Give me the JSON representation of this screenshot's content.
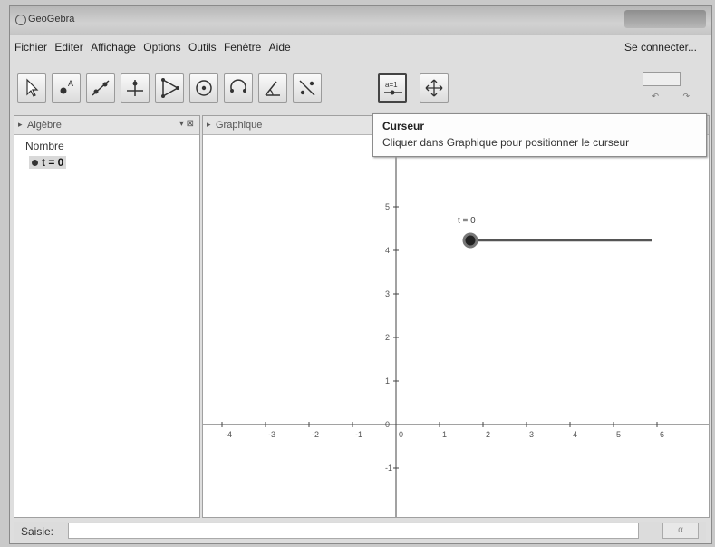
{
  "window": {
    "title": "GeoGebra"
  },
  "menu": {
    "items": [
      "Fichier",
      "Editer",
      "Affichage",
      "Options",
      "Outils",
      "Fenêtre",
      "Aide"
    ],
    "login": "Se connecter..."
  },
  "toolbar": {
    "tools": [
      {
        "icon": "move-arrow-icon"
      },
      {
        "icon": "point-icon"
      },
      {
        "icon": "line-icon"
      },
      {
        "icon": "perpendicular-icon"
      },
      {
        "icon": "polygon-icon"
      },
      {
        "icon": "circle-icon"
      },
      {
        "icon": "arc-icon"
      },
      {
        "icon": "angle-icon"
      },
      {
        "icon": "reflect-icon"
      },
      {
        "icon": "slider-icon"
      },
      {
        "icon": "move-view-icon"
      }
    ],
    "active_tool": "slider-icon"
  },
  "algebra": {
    "header": "Algèbre",
    "category": "Nombre",
    "item": "t = 0"
  },
  "graphics": {
    "header": "Graphique",
    "slider_label": "t = 0",
    "slider_value": 0,
    "x_ticks": [
      "-4",
      "-3",
      "-2",
      "-1",
      "0",
      "1",
      "2",
      "3",
      "4",
      "5",
      "6"
    ],
    "y_ticks": [
      "5",
      "4",
      "3",
      "2",
      "1",
      "0",
      "-1"
    ]
  },
  "tooltip": {
    "title": "Curseur",
    "description": "Cliquer dans Graphique pour positionner le curseur"
  },
  "input_bar": {
    "label": "Saisie:",
    "value": "",
    "button": "α"
  }
}
